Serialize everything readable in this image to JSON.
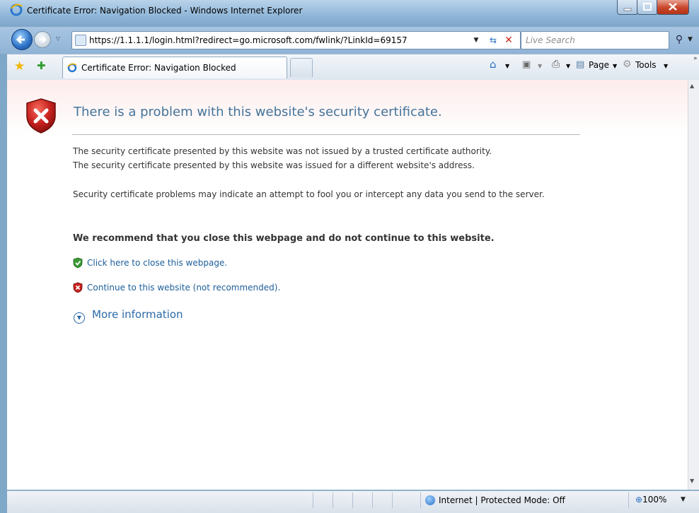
{
  "window": {
    "title": "Certificate Error: Navigation Blocked - Windows Internet Explorer"
  },
  "navbar": {
    "address_url": "https://1.1.1.1/login.html?redirect=go.microsoft.com/fwlink/?LinkId=69157",
    "search_placeholder": "Live Search"
  },
  "tabbar": {
    "active_tab_label": "Certificate Error: Navigation Blocked",
    "commands": {
      "page": "Page",
      "tools": "Tools"
    }
  },
  "content": {
    "heading": "There is a problem with this website's security certificate.",
    "para1_line1": "The security certificate presented by this website was not issued by a trusted certificate authority.",
    "para1_line2": "The security certificate presented by this website was issued for a different website's address.",
    "para2": "Security certificate problems may indicate an attempt to fool you or intercept any data you send to the server.",
    "recommend": "We recommend that you close this webpage and do not continue to this website.",
    "close_link": "Click here to close this webpage.",
    "continue_link": "Continue to this website (not recommended).",
    "more_info": "More information"
  },
  "statusbar": {
    "zone": "Internet | Protected Mode: Off",
    "zoom": "100%"
  },
  "colors": {
    "heading": "#44749a",
    "link": "#1d5e9a",
    "shield_red": "#c8221e",
    "shield_green": "#3a9a32"
  }
}
